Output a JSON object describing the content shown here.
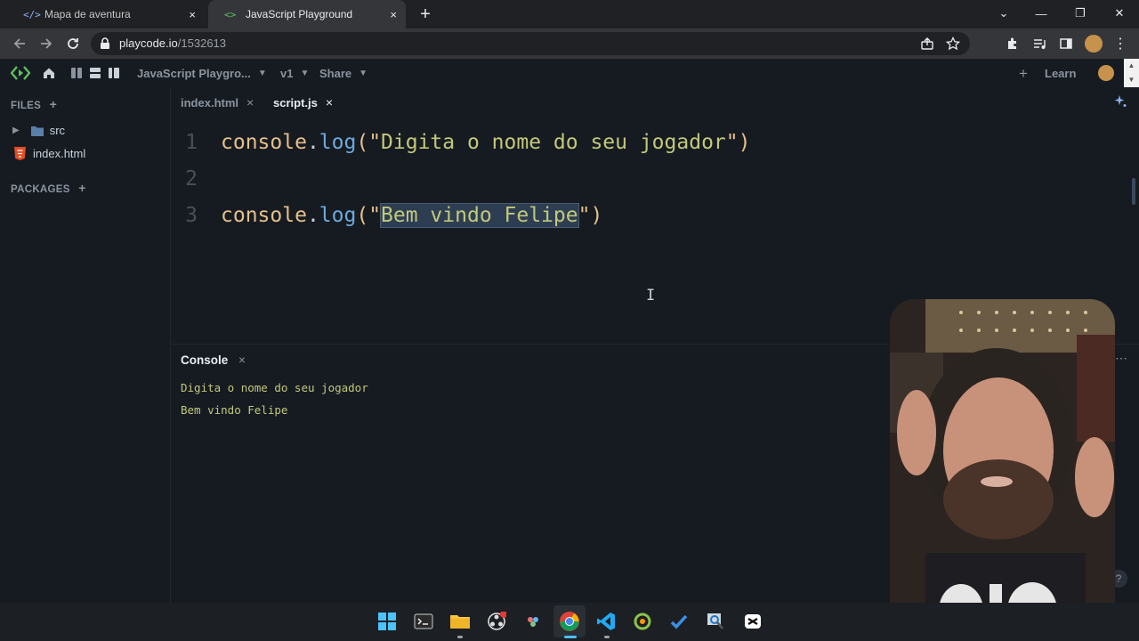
{
  "browser": {
    "tabs": [
      {
        "icon": "</>",
        "title": "Mapa de aventura",
        "close": "×"
      },
      {
        "icon": "<>",
        "title": "JavaScript Playground",
        "close": "×"
      }
    ],
    "new_tab": "+",
    "window": {
      "chevron": "⌄",
      "minimize": "—",
      "restore": "❐",
      "close": "✕"
    },
    "url_host": "playcode.io",
    "url_path": "/1532613"
  },
  "app": {
    "project_name": "JavaScript Playgro...",
    "version": "v1",
    "share": "Share",
    "add": "+",
    "learn": "Learn"
  },
  "sidebar": {
    "files_header": "FILES",
    "files_add": "+",
    "items": [
      {
        "label": "src"
      },
      {
        "label": "index.html"
      }
    ],
    "packages_header": "PACKAGES",
    "packages_add": "+"
  },
  "editor": {
    "tabs": [
      {
        "label": "index.html",
        "close": "×"
      },
      {
        "label": "script.js",
        "close": "×"
      }
    ],
    "lines": [
      {
        "num": "1",
        "obj": "console",
        "dot": ".",
        "fn": "log",
        "open": "(\"",
        "str_pre": "Digita o nome do seu jogador",
        "str_sel": "",
        "close": "\")"
      },
      {
        "num": "2"
      },
      {
        "num": "3",
        "obj": "console",
        "dot": ".",
        "fn": "log",
        "open": "(\"",
        "str_pre": "",
        "str_sel": "Bem vindo Felipe",
        "close": "\")"
      }
    ]
  },
  "console": {
    "title": "Console",
    "close": "×",
    "output": [
      "Digita o nome do seu jogador",
      "Bem vindo Felipe"
    ]
  },
  "colors": {
    "background": "#161b22",
    "keyword": "#e6c08a",
    "function": "#6fa8dc",
    "string": "#c3c87a",
    "accent_green": "#5ec15e"
  }
}
